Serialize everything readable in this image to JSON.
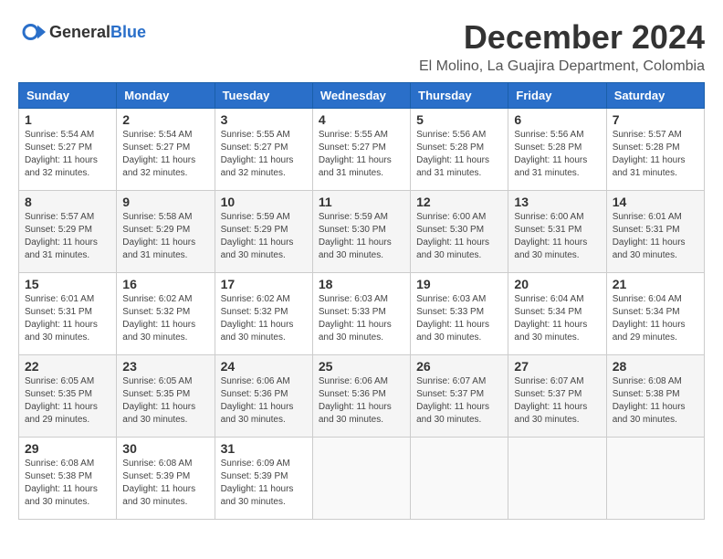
{
  "logo": {
    "text_general": "General",
    "text_blue": "Blue"
  },
  "title": "December 2024",
  "location": "El Molino, La Guajira Department, Colombia",
  "days_of_week": [
    "Sunday",
    "Monday",
    "Tuesday",
    "Wednesday",
    "Thursday",
    "Friday",
    "Saturday"
  ],
  "weeks": [
    [
      {
        "day": "1",
        "sunrise": "5:54 AM",
        "sunset": "5:27 PM",
        "daylight": "11 hours and 32 minutes."
      },
      {
        "day": "2",
        "sunrise": "5:54 AM",
        "sunset": "5:27 PM",
        "daylight": "11 hours and 32 minutes."
      },
      {
        "day": "3",
        "sunrise": "5:55 AM",
        "sunset": "5:27 PM",
        "daylight": "11 hours and 32 minutes."
      },
      {
        "day": "4",
        "sunrise": "5:55 AM",
        "sunset": "5:27 PM",
        "daylight": "11 hours and 31 minutes."
      },
      {
        "day": "5",
        "sunrise": "5:56 AM",
        "sunset": "5:28 PM",
        "daylight": "11 hours and 31 minutes."
      },
      {
        "day": "6",
        "sunrise": "5:56 AM",
        "sunset": "5:28 PM",
        "daylight": "11 hours and 31 minutes."
      },
      {
        "day": "7",
        "sunrise": "5:57 AM",
        "sunset": "5:28 PM",
        "daylight": "11 hours and 31 minutes."
      }
    ],
    [
      {
        "day": "8",
        "sunrise": "5:57 AM",
        "sunset": "5:29 PM",
        "daylight": "11 hours and 31 minutes."
      },
      {
        "day": "9",
        "sunrise": "5:58 AM",
        "sunset": "5:29 PM",
        "daylight": "11 hours and 31 minutes."
      },
      {
        "day": "10",
        "sunrise": "5:59 AM",
        "sunset": "5:29 PM",
        "daylight": "11 hours and 30 minutes."
      },
      {
        "day": "11",
        "sunrise": "5:59 AM",
        "sunset": "5:30 PM",
        "daylight": "11 hours and 30 minutes."
      },
      {
        "day": "12",
        "sunrise": "6:00 AM",
        "sunset": "5:30 PM",
        "daylight": "11 hours and 30 minutes."
      },
      {
        "day": "13",
        "sunrise": "6:00 AM",
        "sunset": "5:31 PM",
        "daylight": "11 hours and 30 minutes."
      },
      {
        "day": "14",
        "sunrise": "6:01 AM",
        "sunset": "5:31 PM",
        "daylight": "11 hours and 30 minutes."
      }
    ],
    [
      {
        "day": "15",
        "sunrise": "6:01 AM",
        "sunset": "5:31 PM",
        "daylight": "11 hours and 30 minutes."
      },
      {
        "day": "16",
        "sunrise": "6:02 AM",
        "sunset": "5:32 PM",
        "daylight": "11 hours and 30 minutes."
      },
      {
        "day": "17",
        "sunrise": "6:02 AM",
        "sunset": "5:32 PM",
        "daylight": "11 hours and 30 minutes."
      },
      {
        "day": "18",
        "sunrise": "6:03 AM",
        "sunset": "5:33 PM",
        "daylight": "11 hours and 30 minutes."
      },
      {
        "day": "19",
        "sunrise": "6:03 AM",
        "sunset": "5:33 PM",
        "daylight": "11 hours and 30 minutes."
      },
      {
        "day": "20",
        "sunrise": "6:04 AM",
        "sunset": "5:34 PM",
        "daylight": "11 hours and 30 minutes."
      },
      {
        "day": "21",
        "sunrise": "6:04 AM",
        "sunset": "5:34 PM",
        "daylight": "11 hours and 29 minutes."
      }
    ],
    [
      {
        "day": "22",
        "sunrise": "6:05 AM",
        "sunset": "5:35 PM",
        "daylight": "11 hours and 29 minutes."
      },
      {
        "day": "23",
        "sunrise": "6:05 AM",
        "sunset": "5:35 PM",
        "daylight": "11 hours and 30 minutes."
      },
      {
        "day": "24",
        "sunrise": "6:06 AM",
        "sunset": "5:36 PM",
        "daylight": "11 hours and 30 minutes."
      },
      {
        "day": "25",
        "sunrise": "6:06 AM",
        "sunset": "5:36 PM",
        "daylight": "11 hours and 30 minutes."
      },
      {
        "day": "26",
        "sunrise": "6:07 AM",
        "sunset": "5:37 PM",
        "daylight": "11 hours and 30 minutes."
      },
      {
        "day": "27",
        "sunrise": "6:07 AM",
        "sunset": "5:37 PM",
        "daylight": "11 hours and 30 minutes."
      },
      {
        "day": "28",
        "sunrise": "6:08 AM",
        "sunset": "5:38 PM",
        "daylight": "11 hours and 30 minutes."
      }
    ],
    [
      {
        "day": "29",
        "sunrise": "6:08 AM",
        "sunset": "5:38 PM",
        "daylight": "11 hours and 30 minutes."
      },
      {
        "day": "30",
        "sunrise": "6:08 AM",
        "sunset": "5:39 PM",
        "daylight": "11 hours and 30 minutes."
      },
      {
        "day": "31",
        "sunrise": "6:09 AM",
        "sunset": "5:39 PM",
        "daylight": "11 hours and 30 minutes."
      },
      null,
      null,
      null,
      null
    ]
  ]
}
